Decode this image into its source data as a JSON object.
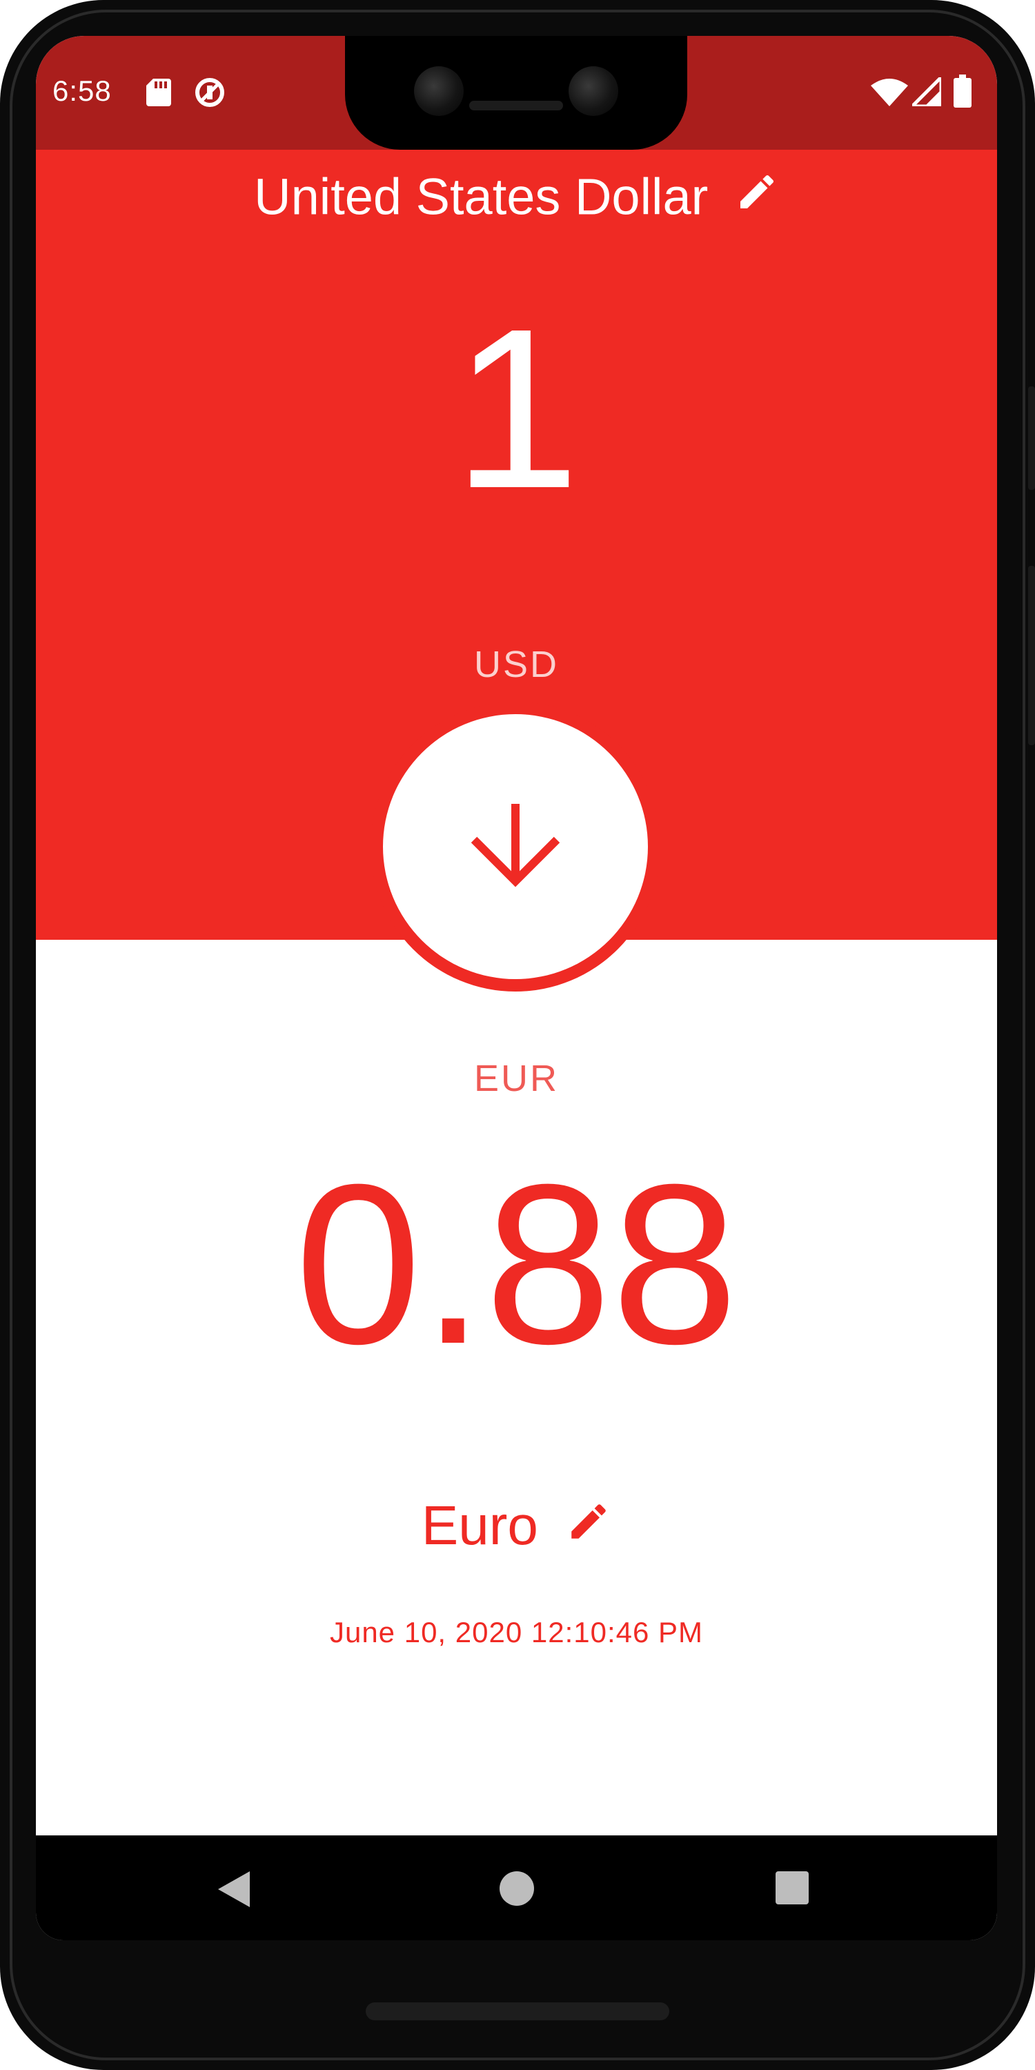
{
  "status_bar": {
    "time": "6:58",
    "icons": [
      "sd-card-icon",
      "data-saver-icon",
      "wifi-icon",
      "signal-icon",
      "battery-icon"
    ]
  },
  "from_currency": {
    "name": "United States Dollar",
    "amount": "1",
    "code": "USD"
  },
  "swap_button": {
    "icon": "arrow-down-icon"
  },
  "to_currency": {
    "code": "EUR",
    "amount": "0.88",
    "name": "Euro"
  },
  "timestamp": "June 10, 2020 12:10:46 PM",
  "nav_bar": {
    "buttons": [
      "back-icon",
      "home-icon",
      "recents-icon"
    ]
  },
  "colors": {
    "accent": "#ef2a24",
    "status_bar": "#aa1e1c",
    "background": "#ffffff",
    "code_light": "#fbd0ce"
  }
}
